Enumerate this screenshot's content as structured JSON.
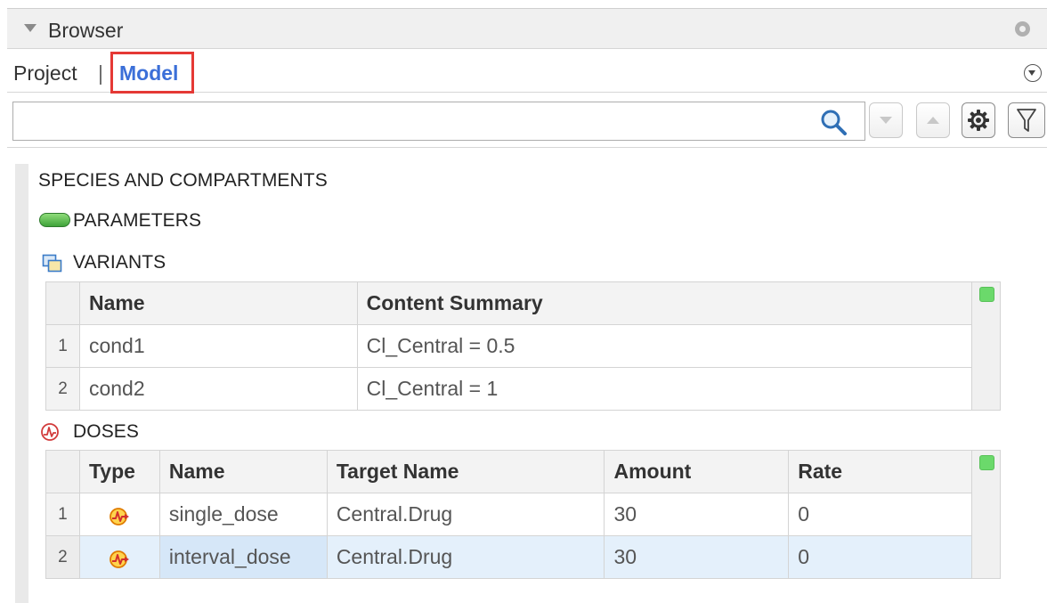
{
  "panel": {
    "title": "Browser"
  },
  "tabs": {
    "project": "Project",
    "separator": "|",
    "model": "Model",
    "active": "Model"
  },
  "search": {
    "value": "",
    "placeholder": ""
  },
  "toolbar_icons": [
    "search-icon",
    "chevron-down-icon",
    "chevron-up-icon",
    "gear-icon",
    "filter-icon"
  ],
  "sections": {
    "species": "SPECIES AND COMPARTMENTS",
    "parameters": "PARAMETERS",
    "variants": "VARIANTS",
    "doses": "DOSES"
  },
  "variants_table": {
    "columns": [
      "Name",
      "Content Summary"
    ],
    "rows": [
      {
        "index": "1",
        "name": "cond1",
        "summary": "Cl_Central = 0.5"
      },
      {
        "index": "2",
        "name": "cond2",
        "summary": "Cl_Central = 1"
      }
    ]
  },
  "doses_table": {
    "columns": [
      "Type",
      "Name",
      "Target Name",
      "Amount",
      "Rate"
    ],
    "rows": [
      {
        "index": "1",
        "type_icon": "dose-icon",
        "name": "single_dose",
        "target": "Central.Drug",
        "amount": "30",
        "rate": "0"
      },
      {
        "index": "2",
        "type_icon": "dose-icon",
        "name": "interval_dose",
        "target": "Central.Drug",
        "amount": "30",
        "rate": "0"
      }
    ],
    "selected_row": "2"
  },
  "colors": {
    "active_tab": "#3b6fd8",
    "highlight_border": "#e53935",
    "status_green": "#6bd96b",
    "selected_row": "#e4f0fb"
  }
}
